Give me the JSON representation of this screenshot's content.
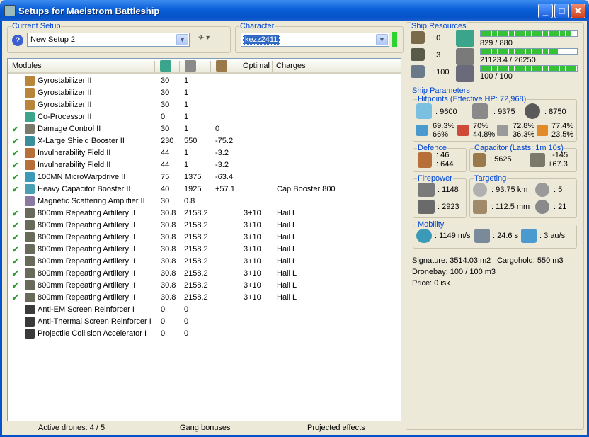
{
  "window": {
    "title": "Setups for Maelstrom Battleship"
  },
  "current_setup": {
    "label": "Current Setup",
    "value": "New Setup 2"
  },
  "character": {
    "label": "Character",
    "value": "kezz2411"
  },
  "modules": {
    "headers": [
      "Modules",
      "Optimal",
      "Charges"
    ],
    "rows": [
      {
        "checked": false,
        "name": "Gyrostabilizer II",
        "cpu": "30",
        "pg": "1",
        "cap": "",
        "optimal": "",
        "charges": "",
        "icon": "gyrostabilizer-icon",
        "color": "#b8863b"
      },
      {
        "checked": false,
        "name": "Gyrostabilizer II",
        "cpu": "30",
        "pg": "1",
        "cap": "",
        "optimal": "",
        "charges": "",
        "icon": "gyrostabilizer-icon",
        "color": "#b8863b"
      },
      {
        "checked": false,
        "name": "Gyrostabilizer II",
        "cpu": "30",
        "pg": "1",
        "cap": "",
        "optimal": "",
        "charges": "",
        "icon": "gyrostabilizer-icon",
        "color": "#b8863b"
      },
      {
        "checked": false,
        "name": "Co-Processor II",
        "cpu": "0",
        "pg": "1",
        "cap": "",
        "optimal": "",
        "charges": "",
        "icon": "co-processor-icon",
        "color": "#3aa58a"
      },
      {
        "checked": true,
        "name": "Damage Control II",
        "cpu": "30",
        "pg": "1",
        "cap": "0",
        "optimal": "",
        "charges": "",
        "icon": "damage-control-icon",
        "color": "#7a7a6a"
      },
      {
        "checked": true,
        "name": "X-Large Shield Booster II",
        "cpu": "230",
        "pg": "550",
        "cap": "-75.2",
        "optimal": "",
        "charges": "",
        "icon": "shield-booster-icon",
        "color": "#3a8f9a"
      },
      {
        "checked": true,
        "name": "Invulnerability Field II",
        "cpu": "44",
        "pg": "1",
        "cap": "-3.2",
        "optimal": "",
        "charges": "",
        "icon": "invulnerability-field-icon",
        "color": "#b8703a"
      },
      {
        "checked": true,
        "name": "Invulnerability Field II",
        "cpu": "44",
        "pg": "1",
        "cap": "-3.2",
        "optimal": "",
        "charges": "",
        "icon": "invulnerability-field-icon",
        "color": "#b8703a"
      },
      {
        "checked": true,
        "name": "100MN MicroWarpdrive II",
        "cpu": "75",
        "pg": "1375",
        "cap": "-63.4",
        "optimal": "",
        "charges": "",
        "icon": "microwarpdrive-icon",
        "color": "#3a9ab8"
      },
      {
        "checked": true,
        "name": "Heavy Capacitor Booster II",
        "cpu": "40",
        "pg": "1925",
        "cap": "+57.1",
        "optimal": "",
        "charges": "Cap Booster 800",
        "icon": "capacitor-booster-icon",
        "color": "#4aa0b0"
      },
      {
        "checked": false,
        "name": "Magnetic Scattering Amplifier II",
        "cpu": "30",
        "pg": "0.8",
        "cap": "",
        "optimal": "",
        "charges": "",
        "icon": "scattering-amplifier-icon",
        "color": "#8a7aa0"
      },
      {
        "checked": true,
        "name": "800mm Repeating Artillery II",
        "cpu": "30.8",
        "pg": "2158.2",
        "cap": "",
        "optimal": "3+10",
        "charges": "Hail L",
        "icon": "artillery-icon",
        "color": "#6a6a5a"
      },
      {
        "checked": true,
        "name": "800mm Repeating Artillery II",
        "cpu": "30.8",
        "pg": "2158.2",
        "cap": "",
        "optimal": "3+10",
        "charges": "Hail L",
        "icon": "artillery-icon",
        "color": "#6a6a5a"
      },
      {
        "checked": true,
        "name": "800mm Repeating Artillery II",
        "cpu": "30.8",
        "pg": "2158.2",
        "cap": "",
        "optimal": "3+10",
        "charges": "Hail L",
        "icon": "artillery-icon",
        "color": "#6a6a5a"
      },
      {
        "checked": true,
        "name": "800mm Repeating Artillery II",
        "cpu": "30.8",
        "pg": "2158.2",
        "cap": "",
        "optimal": "3+10",
        "charges": "Hail L",
        "icon": "artillery-icon",
        "color": "#6a6a5a"
      },
      {
        "checked": true,
        "name": "800mm Repeating Artillery II",
        "cpu": "30.8",
        "pg": "2158.2",
        "cap": "",
        "optimal": "3+10",
        "charges": "Hail L",
        "icon": "artillery-icon",
        "color": "#6a6a5a"
      },
      {
        "checked": true,
        "name": "800mm Repeating Artillery II",
        "cpu": "30.8",
        "pg": "2158.2",
        "cap": "",
        "optimal": "3+10",
        "charges": "Hail L",
        "icon": "artillery-icon",
        "color": "#6a6a5a"
      },
      {
        "checked": true,
        "name": "800mm Repeating Artillery II",
        "cpu": "30.8",
        "pg": "2158.2",
        "cap": "",
        "optimal": "3+10",
        "charges": "Hail L",
        "icon": "artillery-icon",
        "color": "#6a6a5a"
      },
      {
        "checked": true,
        "name": "800mm Repeating Artillery II",
        "cpu": "30.8",
        "pg": "2158.2",
        "cap": "",
        "optimal": "3+10",
        "charges": "Hail L",
        "icon": "artillery-icon",
        "color": "#6a6a5a"
      },
      {
        "checked": false,
        "name": "Anti-EM Screen Reinforcer I",
        "cpu": "0",
        "pg": "0",
        "cap": "",
        "optimal": "",
        "charges": "",
        "icon": "rig-icon",
        "color": "#3a3a3a"
      },
      {
        "checked": false,
        "name": "Anti-Thermal Screen Reinforcer I",
        "cpu": "0",
        "pg": "0",
        "cap": "",
        "optimal": "",
        "charges": "",
        "icon": "rig-icon",
        "color": "#3a3a3a"
      },
      {
        "checked": false,
        "name": "Projectile Collision Accelerator I",
        "cpu": "0",
        "pg": "0",
        "cap": "",
        "optimal": "",
        "charges": "",
        "icon": "rig-icon",
        "color": "#3a3a3a"
      }
    ]
  },
  "status": {
    "drones": "Active drones: 4 / 5",
    "gang": "Gang bonuses",
    "projected": "Projected effects"
  },
  "resources": {
    "label": "Ship Resources",
    "turret_hardpoints": ": 0",
    "launcher_hardpoints": ": 3",
    "calibration": ": 100",
    "cpu": "829 / 880",
    "cpu_fill": 0.942,
    "powergrid": "21123.4 / 26250",
    "powergrid_fill": 0.805,
    "drone_bandwidth": "100 / 100",
    "drone_fill": 1.0
  },
  "params": {
    "label": "Ship Parameters",
    "hitpoints": {
      "label": "Hitpoints (Effective HP: 72,968)",
      "shield": ": 9600",
      "armor": ": 9375",
      "structure": ": 8750",
      "em": [
        "69.3%",
        "66%"
      ],
      "thermal": [
        "70%",
        "44.8%"
      ],
      "kinetic": [
        "72.8%",
        "36.3%"
      ],
      "explosive": [
        "77.4%",
        "23.5%"
      ]
    },
    "defence": {
      "label": "Defence",
      "top": ": 46",
      "bottom": ": 644"
    },
    "capacitor": {
      "label": "Capacitor (Lasts: 1m 10s)",
      "amount": ": 5625",
      "top": ": -145",
      "bottom": "+67.3"
    },
    "firepower": {
      "label": "Firepower",
      "top": ": 1148",
      "bottom": ": 2923"
    },
    "targeting": {
      "label": "Targeting",
      "range": ": 93.75 km",
      "targets": ": 5",
      "resolution": ": 112.5 mm",
      "sensor": ": 21"
    },
    "mobility": {
      "label": "Mobility",
      "speed": ": 1149 m/s",
      "align": ": 24.6 s",
      "warp": ": 3 au/s"
    },
    "signature": "Signature: 3514.03 m2",
    "cargohold": "Cargohold: 550 m3",
    "dronebay": "Dronebay: 100 / 100 m3",
    "price": "Price: 0 isk"
  },
  "colors": {
    "accent": "#0046d5",
    "titlebar": "#0553c9",
    "check": "#2e9a2e",
    "bar": "#35c235"
  }
}
